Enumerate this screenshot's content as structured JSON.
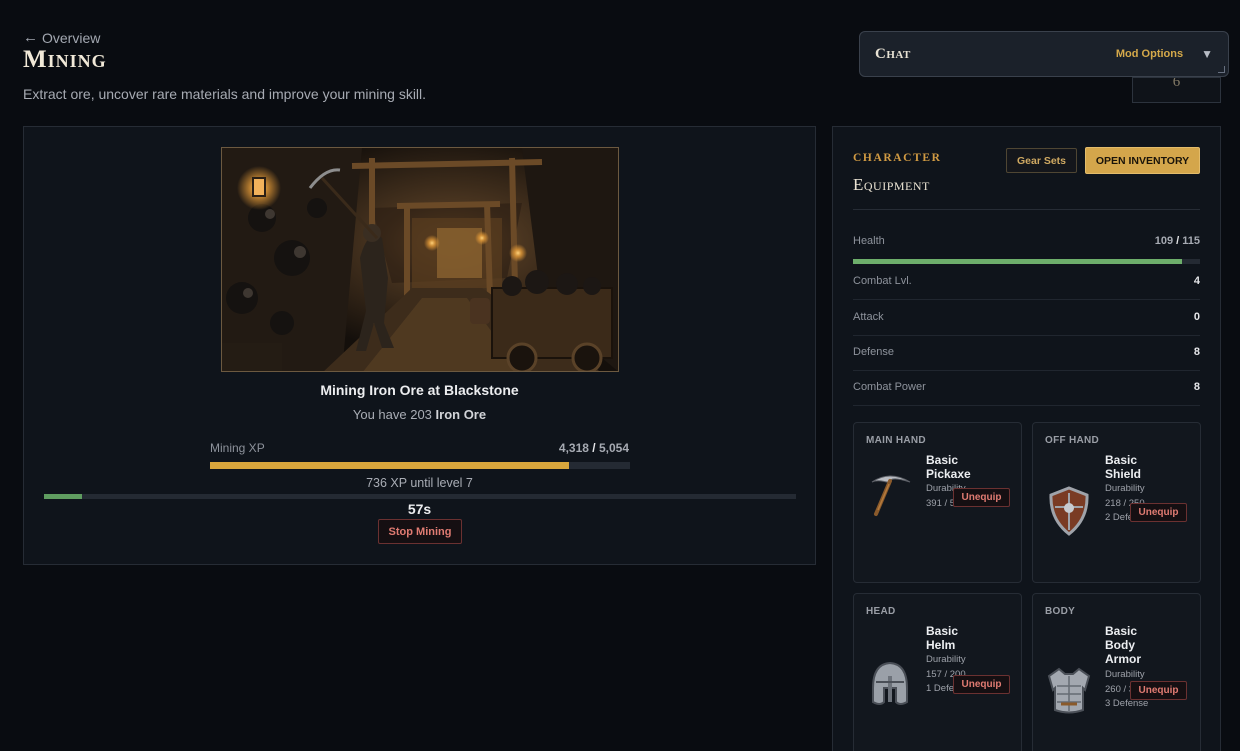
{
  "header": {
    "back_label": "Overview",
    "title": "Mining",
    "subtitle": "Extract ore, uncover rare materials and improve your mining skill."
  },
  "chat": {
    "title": "Chat",
    "mod_options": "Mod Options",
    "toggle_icon": "chevron-down-icon",
    "peek_value": "6"
  },
  "activity": {
    "title": "Mining Iron Ore at Blackstone",
    "owned_prefix": "You have 203 ",
    "owned_item": "Iron Ore",
    "xp_label": "Mining XP",
    "xp_current": "4,318",
    "xp_sep": " / ",
    "xp_max": "5,054",
    "xp_fraction": 0.854,
    "xp_remaining": "736 XP until level 7",
    "timer_text": "57s",
    "timer_fraction": 0.05,
    "stop_label": "Stop Mining",
    "colors": {
      "xp_bar": "#d9a63c",
      "timer_bar": "#5f9d60",
      "danger": "#e07b72"
    }
  },
  "equipment": {
    "kicker": "Character",
    "title": "Equipment",
    "gear_sets_label": "Gear Sets",
    "open_inventory_label": "OPEN INVENTORY",
    "health": {
      "label": "Health",
      "current": "109",
      "sep": " / ",
      "max": "115",
      "fraction": 0.948
    },
    "stats": [
      {
        "label": "Combat Lvl.",
        "value": "4"
      },
      {
        "label": "Attack",
        "value": "0"
      },
      {
        "label": "Defense",
        "value": "8"
      },
      {
        "label": "Combat Power",
        "value": "8"
      }
    ],
    "slots": [
      {
        "slot": "MAIN HAND",
        "name": "Basic Pickaxe",
        "meta": "Durability 391 / 500",
        "action": "Unequip",
        "icon": "pickaxe-icon"
      },
      {
        "slot": "OFF HAND",
        "name": "Basic Shield",
        "meta": "Durability 218 / 250 2 Defense",
        "action": "Unequip",
        "icon": "shield-icon"
      },
      {
        "slot": "HEAD",
        "name": "Basic Helm",
        "meta": "Durability 157 / 200 1 Defense",
        "action": "Unequip",
        "icon": "helmet-icon"
      },
      {
        "slot": "BODY",
        "name": "Basic Body Armor",
        "meta": "Durability 260 / 300 3 Defense",
        "action": "Unequip",
        "icon": "armor-icon"
      }
    ],
    "colors": {
      "accent": "#d4a64b",
      "health_bar": "#6dae6b"
    }
  }
}
